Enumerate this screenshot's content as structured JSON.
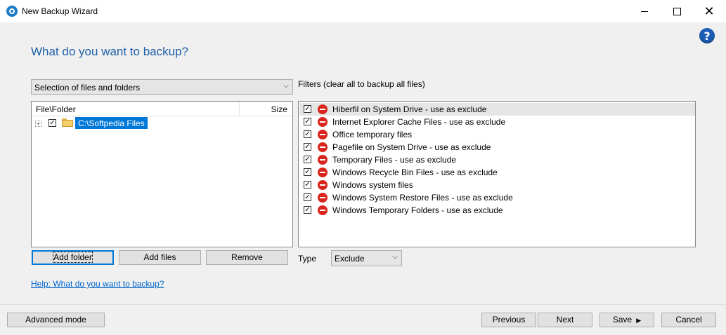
{
  "window": {
    "title": "New Backup Wizard"
  },
  "page": {
    "heading": "What do you want to backup?",
    "help_icon": "?"
  },
  "source_select": {
    "value": "Selection of files and folders"
  },
  "tree": {
    "col_file": "File\\Folder",
    "col_size": "Size",
    "items": [
      {
        "label": "C:\\Softpedia Files",
        "checked": true,
        "expander": "+"
      }
    ]
  },
  "filters": {
    "label": "Filters (clear all to backup all files)",
    "items": [
      {
        "label": "Hiberfil on System Drive - use as exclude",
        "checked": true
      },
      {
        "label": "Internet Explorer Cache Files - use as exclude",
        "checked": true
      },
      {
        "label": "Office temporary files",
        "checked": true
      },
      {
        "label": "Pagefile on System Drive - use as exclude",
        "checked": true
      },
      {
        "label": "Temporary Files - use as exclude",
        "checked": true
      },
      {
        "label": "Windows Recycle Bin Files - use as exclude",
        "checked": true
      },
      {
        "label": "Windows system files",
        "checked": true
      },
      {
        "label": "Windows System Restore Files - use as exclude",
        "checked": true
      },
      {
        "label": "Windows Temporary Folders - use as exclude",
        "checked": true
      }
    ]
  },
  "actions": {
    "add_folder": "Add folder",
    "add_files": "Add files",
    "remove": "Remove"
  },
  "type": {
    "label": "Type",
    "value": "Exclude"
  },
  "help_link": "Help: What do you want to backup?",
  "footer": {
    "advanced": "Advanced mode",
    "previous": "Previous",
    "next": "Next",
    "save": "Save",
    "cancel": "Cancel"
  },
  "colors": {
    "accent": "#0078d7",
    "heading": "#1e5fa8",
    "link": "#0066cc",
    "exclude_icon": "#d9261c"
  },
  "icons": {
    "app": "app-logo-icon",
    "folder": "folder-icon",
    "exclude": "no-entry-icon",
    "help": "help-icon"
  }
}
